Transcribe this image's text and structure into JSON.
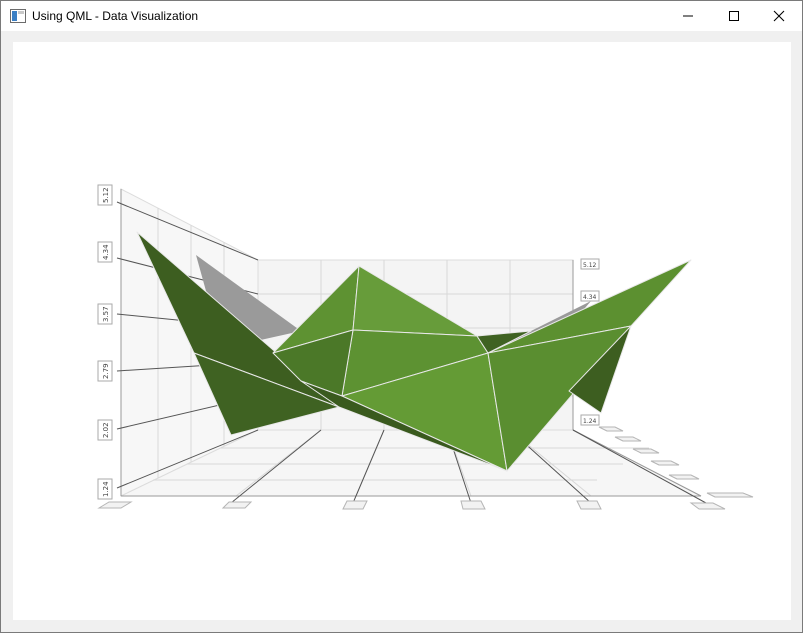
{
  "window": {
    "title": "Using QML - Data Visualization"
  },
  "colors": {
    "surface_light": "#639a34",
    "surface_mid": "#4f7f2a",
    "surface_dark": "#3d5e20",
    "shadow": "#9a9a9a",
    "wireframe": "#e8e8e8"
  },
  "chart_data": {
    "type": "surface",
    "y_axis_tick_labels_left": [
      "5.12",
      "4.34",
      "3.57",
      "2.79",
      "2.02",
      "1.24"
    ],
    "y_axis_tick_labels_right": [
      "5.12",
      "4.34",
      "1.24"
    ]
  }
}
